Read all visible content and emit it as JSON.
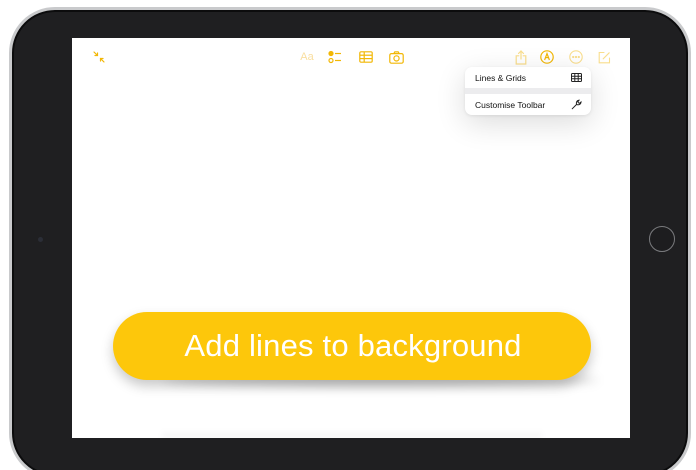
{
  "toolbar": {
    "collapse_icon": "arrows-in-icon",
    "format_label": "Aa",
    "checklist_icon": "checklist-icon",
    "table_icon": "table-icon",
    "camera_icon": "camera-icon",
    "share_icon": "share-icon",
    "markup_icon": "pen-circle-icon",
    "more_icon": "ellipsis-circle-icon",
    "compose_icon": "compose-icon"
  },
  "menu": {
    "items": [
      {
        "label": "Lines & Grids",
        "icon": "grid-icon"
      },
      {
        "label": "Customise Toolbar",
        "icon": "wrench-icon"
      }
    ]
  },
  "callout": {
    "text": "Add lines to background"
  },
  "colors": {
    "accent": "#f2b705",
    "callout": "#fdc70b",
    "device_frame": "#1f1f21"
  }
}
